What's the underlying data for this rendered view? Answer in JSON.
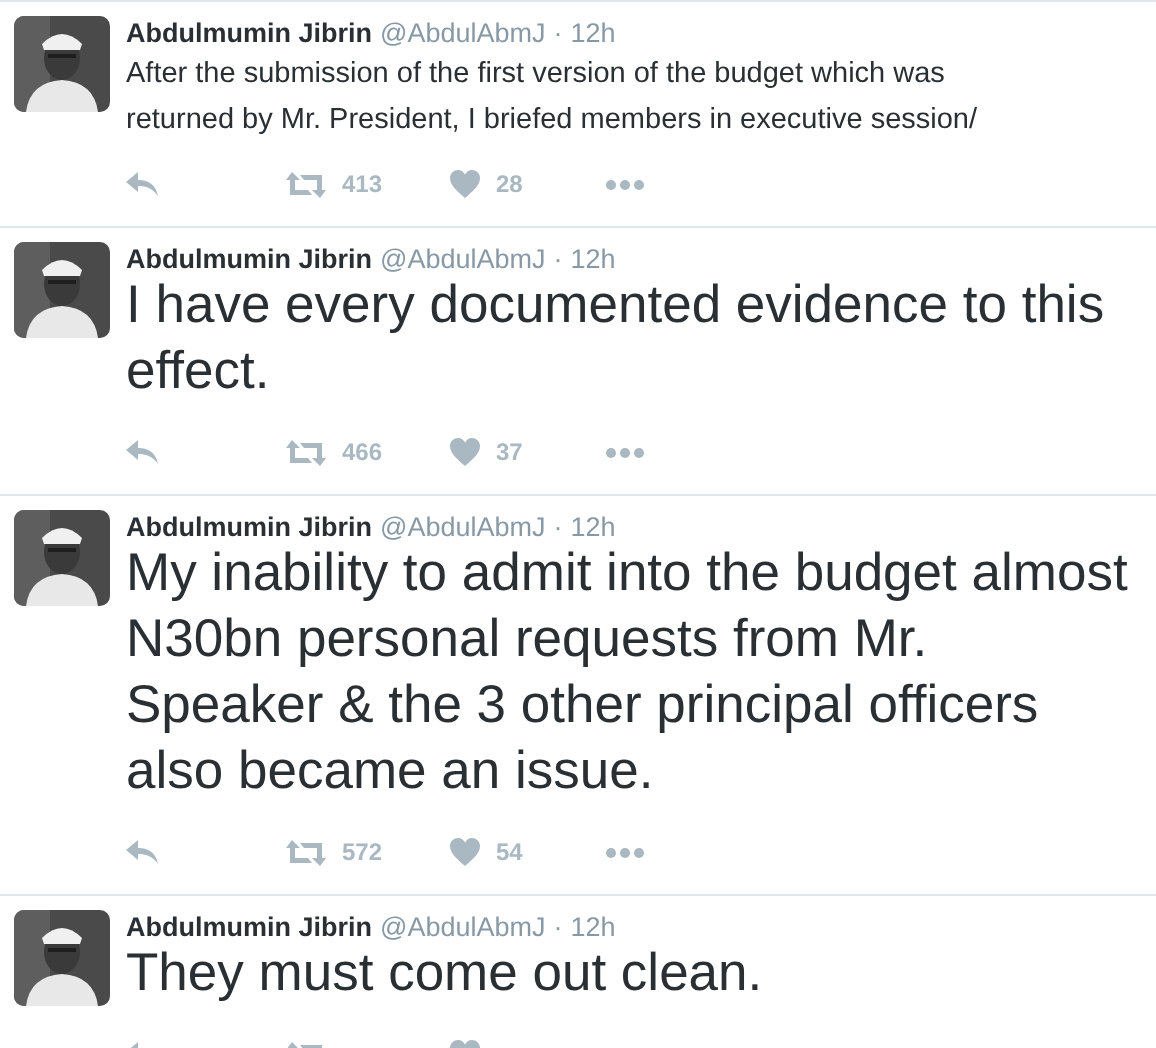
{
  "tweets": [
    {
      "name": "Abdulmumin Jibrin",
      "handle": "@AbdulAbmJ",
      "separator": "·",
      "time": "12h",
      "text": "After the submission of the first version of the budget which was returned by Mr. President, I briefed members in executive session/",
      "kind": "small",
      "retweets": "413",
      "likes": "28"
    },
    {
      "name": "Abdulmumin Jibrin",
      "handle": "@AbdulAbmJ",
      "separator": "·",
      "time": "12h",
      "text": "I have every documented evidence to this effect.",
      "kind": "large",
      "retweets": "466",
      "likes": "37"
    },
    {
      "name": "Abdulmumin Jibrin",
      "handle": "@AbdulAbmJ",
      "separator": "·",
      "time": "12h",
      "text": "My inability to admit into the budget almost N30bn personal requests from Mr. Speaker & the 3 other principal officers also became an issue.",
      "kind": "large",
      "retweets": "572",
      "likes": "54"
    },
    {
      "name": "Abdulmumin Jibrin",
      "handle": "@AbdulAbmJ",
      "separator": "·",
      "time": "12h",
      "text": "They must come out clean.",
      "kind": "large"
    }
  ]
}
